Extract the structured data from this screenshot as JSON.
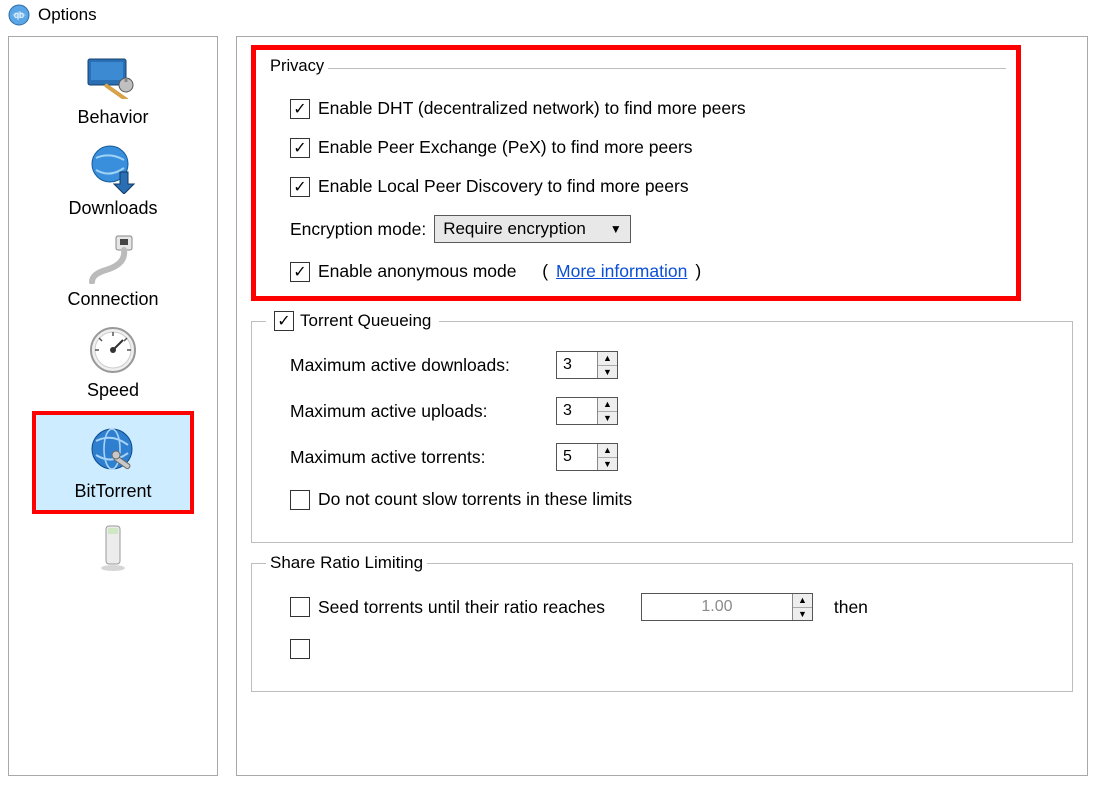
{
  "window": {
    "title": "Options"
  },
  "sidebar": {
    "items": [
      {
        "id": "behavior",
        "label": "Behavior",
        "icon": "display-tools"
      },
      {
        "id": "downloads",
        "label": "Downloads",
        "icon": "globe-down"
      },
      {
        "id": "connection",
        "label": "Connection",
        "icon": "ethernet-plug"
      },
      {
        "id": "speed",
        "label": "Speed",
        "icon": "gauge"
      },
      {
        "id": "bittorrent",
        "label": "BitTorrent",
        "icon": "globe-wrench",
        "selected": true,
        "highlighted": true
      },
      {
        "id": "webui",
        "label": "",
        "icon": "device-column"
      }
    ]
  },
  "privacy": {
    "title": "Privacy",
    "dht": {
      "checked": true,
      "label": "Enable DHT (decentralized network) to find more peers"
    },
    "pex": {
      "checked": true,
      "label": "Enable Peer Exchange (PeX) to find more peers"
    },
    "lpd": {
      "checked": true,
      "label": "Enable Local Peer Discovery to find more peers"
    },
    "enc_label": "Encryption mode:",
    "enc_value": "Require encryption",
    "anon": {
      "checked": true,
      "label": "Enable anonymous mode"
    },
    "more_info": "More information"
  },
  "queueing": {
    "enabled": true,
    "title": "Torrent Queueing",
    "max_dl": {
      "label": "Maximum active downloads:",
      "value": "3"
    },
    "max_ul": {
      "label": "Maximum active uploads:",
      "value": "3"
    },
    "max_act": {
      "label": "Maximum active torrents:",
      "value": "5"
    },
    "no_slow": {
      "checked": false,
      "label": "Do not count slow torrents in these limits"
    }
  },
  "share": {
    "title": "Share Ratio Limiting",
    "seed_until": {
      "checked": false,
      "label": "Seed torrents until their ratio reaches",
      "value": "1.00",
      "then": "then"
    }
  }
}
